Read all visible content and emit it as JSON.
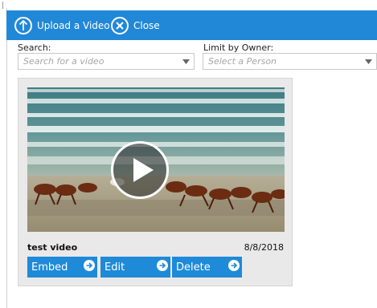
{
  "toolbar": {
    "upload_label": "Upload a Video",
    "close_label": "Close",
    "color": "#2188d8"
  },
  "filters": {
    "search_label": "Search:",
    "search_placeholder": "Search for a video",
    "owner_label": "Limit by Owner:",
    "owner_placeholder": "Select a Person"
  },
  "video": {
    "title": "test video",
    "date": "8/8/2018",
    "actions": [
      {
        "label": "Embed"
      },
      {
        "label": "Edit"
      },
      {
        "label": "Delete"
      }
    ]
  },
  "icons": {
    "upload": "upload-arrow-icon",
    "close": "close-x-icon",
    "play": "play-icon",
    "action": "arrow-right-circle-icon"
  }
}
